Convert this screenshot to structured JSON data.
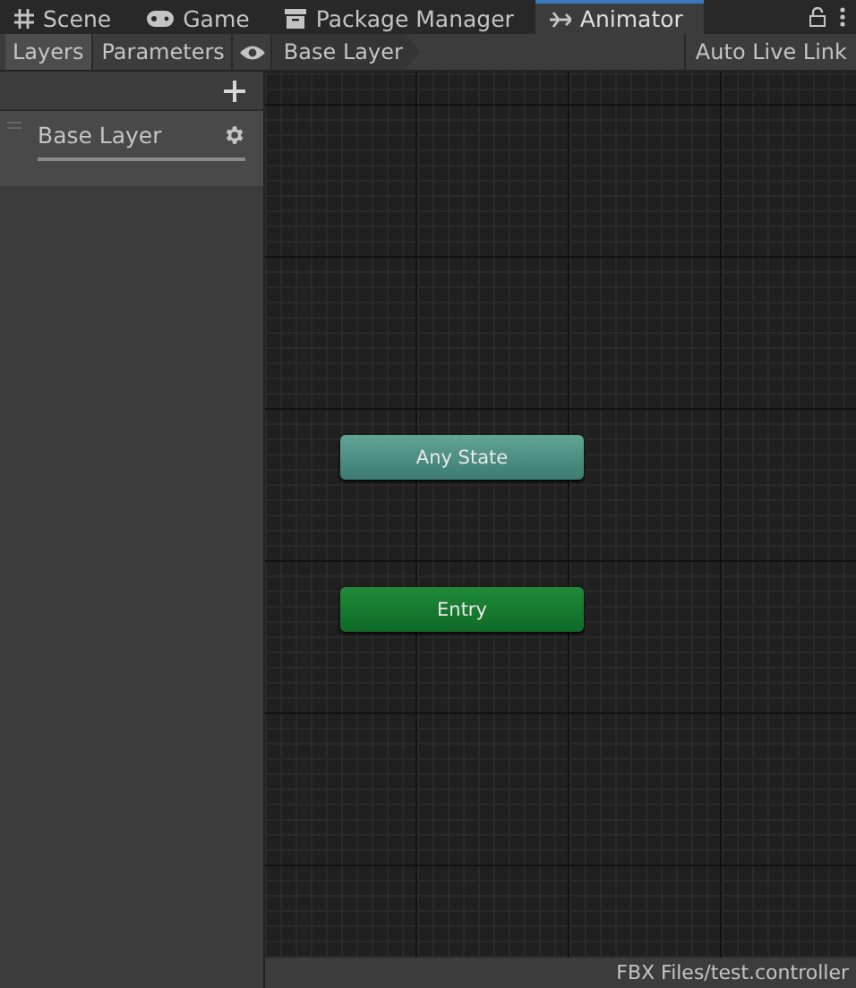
{
  "tabs": [
    {
      "label": "Scene",
      "kind": "grid",
      "selected": false
    },
    {
      "label": "Game",
      "kind": "gamepad",
      "selected": false
    },
    {
      "label": "Package Manager",
      "kind": "box",
      "selected": false
    },
    {
      "label": "Animator",
      "kind": "branch",
      "selected": true
    }
  ],
  "panel_tabs": [
    {
      "label": "Layers",
      "selected": true
    },
    {
      "label": "Parameters",
      "selected": false
    }
  ],
  "breadcrumb": "Base Layer",
  "auto_live_link": {
    "label": "Auto Live Link",
    "on": false
  },
  "layers": [
    {
      "name": "Base Layer",
      "selected": true
    }
  ],
  "nodes": [
    {
      "label": "Any State",
      "kind": "any"
    },
    {
      "label": "Entry",
      "kind": "entry"
    }
  ],
  "status_bar": "FBX Files/test.controller"
}
